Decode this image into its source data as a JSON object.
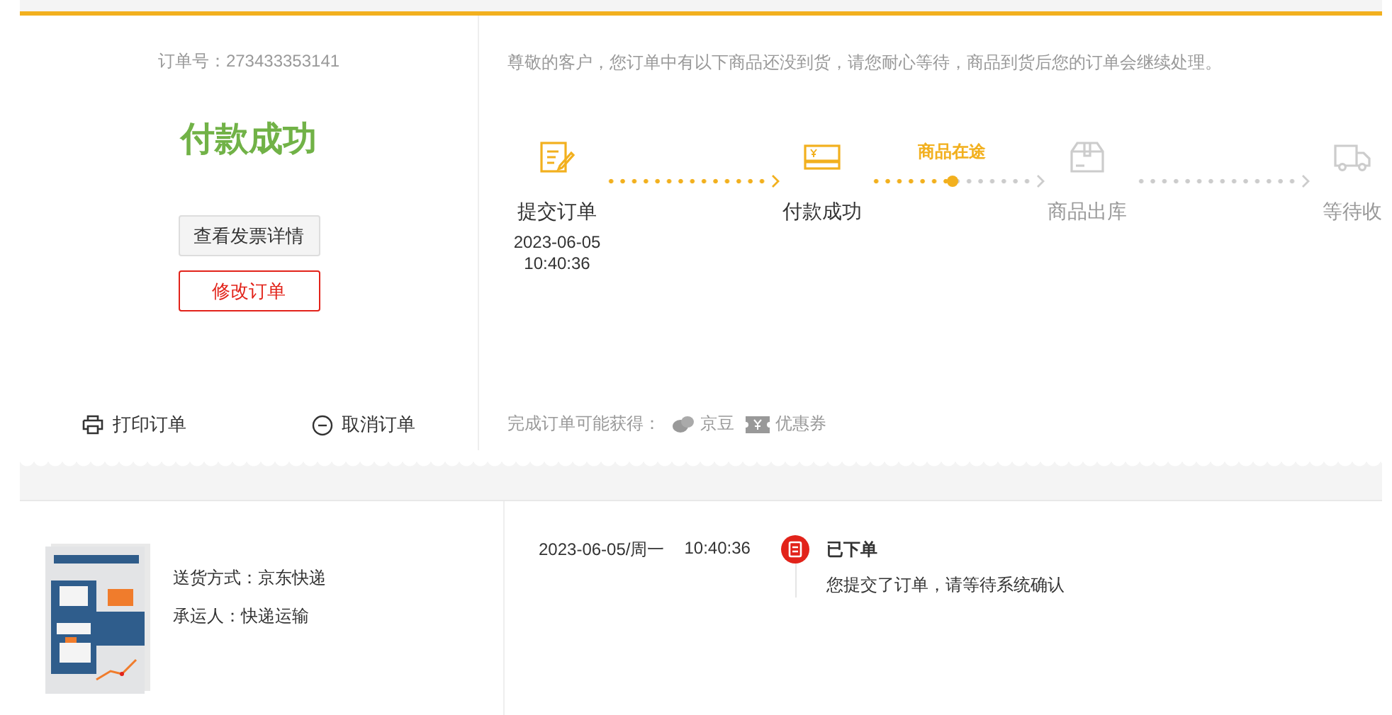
{
  "order": {
    "number_label": "订单号：273433353141",
    "status": "付款成功",
    "buttons": [
      {
        "label": "查看发票详情",
        "kind": "default"
      },
      {
        "label": "修改订单",
        "kind": "danger"
      }
    ],
    "actions": [
      {
        "label": "打印订单",
        "kind": "print"
      },
      {
        "label": "取消订单",
        "kind": "cancel"
      }
    ]
  },
  "notice": "尊敬的客户，您订单中有以下商品还没到货，请您耐心等待，商品到货后您的订单会继续处理。",
  "progress": {
    "steps": [
      {
        "label": "提交订单",
        "kind": "submit",
        "done": true,
        "date": "2023-06-05",
        "time": "10:40:36"
      },
      {
        "label": "付款成功",
        "kind": "payment",
        "done": true
      },
      {
        "label": "商品出库",
        "kind": "outbound",
        "done": false
      },
      {
        "label": "等待收",
        "kind": "delivery",
        "done": false
      }
    ],
    "connectors": [
      {
        "reached": true
      },
      {
        "level": 0.5,
        "label": "商品在途"
      },
      {
        "reached": false
      }
    ]
  },
  "rewards": {
    "label": "完成订单可能获得：",
    "items": [
      {
        "label": "京豆",
        "kind": "bean"
      },
      {
        "label": "优惠券",
        "kind": "coupon"
      }
    ]
  },
  "package": {
    "shipping": "送货方式：京东快递",
    "carrier": "承运人：快递运输"
  },
  "tracking": [
    {
      "date": "2023-06-05/周一",
      "time": "10:40:36",
      "title": "已下单",
      "description": "您提交了订单，请等待系统确认"
    }
  ]
}
